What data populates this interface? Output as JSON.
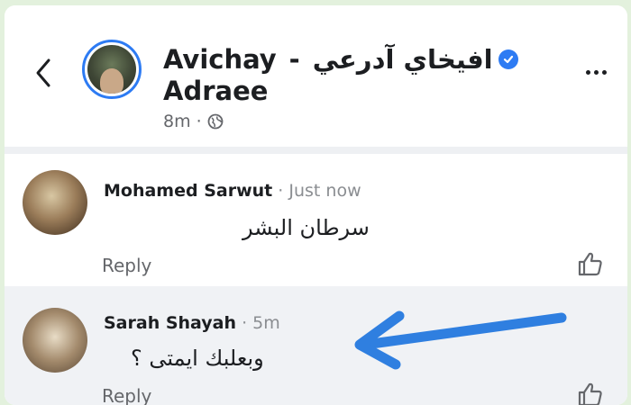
{
  "post": {
    "author_en": "Avichay",
    "author_sep": "-",
    "author_ar": "افيخاي آدرعي",
    "author_en_2": "Adraee",
    "time": "8m",
    "meta_sep": "·"
  },
  "comments": [
    {
      "name": "Mohamed Sarwut",
      "sep": " · ",
      "time": "Just now",
      "text": "سرطان البشر",
      "reply": "Reply"
    },
    {
      "name": "Sarah Shayah",
      "sep": " · ",
      "time": "5m",
      "text": "وبعلبك ايمتى ؟",
      "reply": "Reply"
    }
  ],
  "icons": {
    "back": "chevron-left-icon",
    "verified": "verified-badge-icon",
    "globe": "globe-icon",
    "more": "more-dots-icon",
    "like": "thumbs-up-icon",
    "annotation": "blue-arrow"
  },
  "colors": {
    "accent": "#2d7bf3",
    "highlight_row": "#f0f2f5",
    "frame": "#e3f1dd"
  }
}
